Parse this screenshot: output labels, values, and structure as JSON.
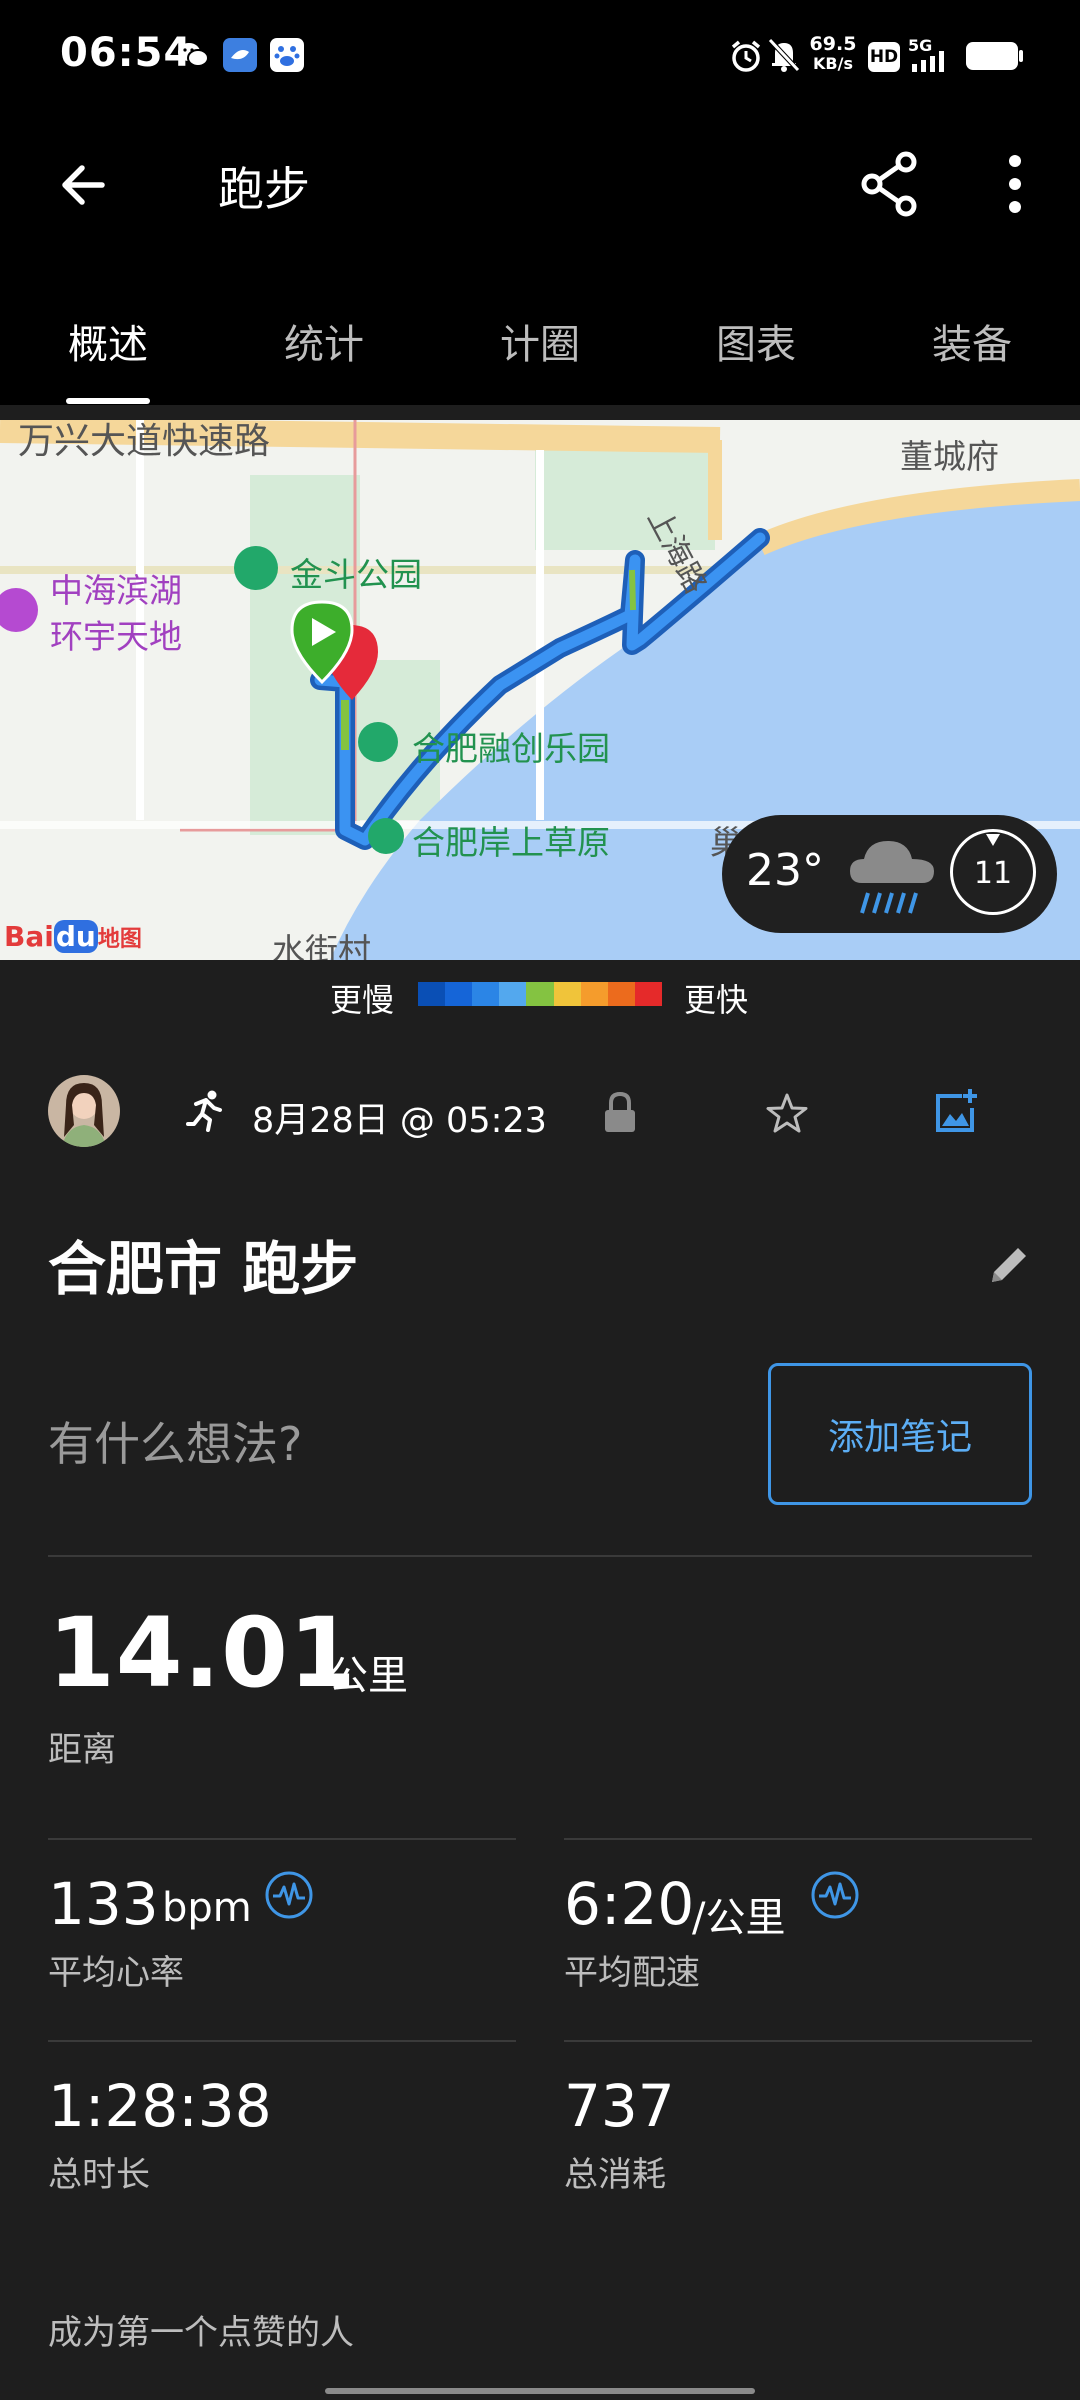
{
  "status_bar": {
    "time": "06:54",
    "net_speed_value": "69.5",
    "net_speed_unit": "KB/s",
    "hd_label": "HD",
    "network": "5G",
    "icons": [
      "wechat-icon",
      "app-icon",
      "baidu-icon",
      "alarm-icon",
      "mute-icon",
      "signal-icon",
      "battery-icon"
    ]
  },
  "app_bar": {
    "title": "跑步",
    "icons": [
      "back-arrow-icon",
      "share-icon",
      "more-vert-icon"
    ]
  },
  "tabs": [
    {
      "label": "概述",
      "active": true
    },
    {
      "label": "统计",
      "active": false
    },
    {
      "label": "计圈",
      "active": false
    },
    {
      "label": "图表",
      "active": false
    },
    {
      "label": "装备",
      "active": false
    }
  ],
  "map": {
    "labels": {
      "road_top": "万兴大道快速路",
      "district": "董城府",
      "park": "金斗公园",
      "mall_line1": "中海滨湖",
      "mall_line2": "环宇天地",
      "road_shanghai": "上海路",
      "amusement": "合肥融创乐园",
      "grassland": "合肥岸上草原",
      "village": "水街村",
      "partial": "巢"
    },
    "logo": {
      "text_bai": "Bai",
      "text_du": "du",
      "text_map": "地图"
    },
    "weather": {
      "temperature": "23°",
      "condition_icon": "rain-cloud-icon",
      "wind_speed": "11"
    },
    "colors": {
      "water": "#a9cdf6",
      "green": "#cfe6d1",
      "road": "#f5d79a",
      "route": "#2d86e8",
      "start": "#3dae2b",
      "end": "#e52a3a"
    }
  },
  "pace_legend": {
    "slow": "更慢",
    "fast": "更快",
    "colors": [
      "#0a4fb5",
      "#1565d8",
      "#2b85e6",
      "#53a8ee",
      "#84c341",
      "#f0c43a",
      "#f59c2c",
      "#ec6b1d",
      "#e52a2a"
    ]
  },
  "activity": {
    "date": "8月28日 @ 05:23",
    "title": "合肥市 跑步",
    "notes_prompt": "有什么想法?",
    "add_note_label": "添加笔记"
  },
  "stats": {
    "distance": {
      "value": "14.01",
      "unit": "公里",
      "label": "距离"
    },
    "heart_rate": {
      "value": "133",
      "unit": "bpm",
      "label": "平均心率"
    },
    "pace": {
      "value": "6:20",
      "unit": "/公里",
      "label": "平均配速"
    },
    "duration": {
      "value": "1:28:38",
      "label": "总时长"
    },
    "calories": {
      "value": "737",
      "label": "总消耗"
    }
  },
  "likes_text": "成为第一个点赞的人",
  "accent_color": "#3f96e6"
}
